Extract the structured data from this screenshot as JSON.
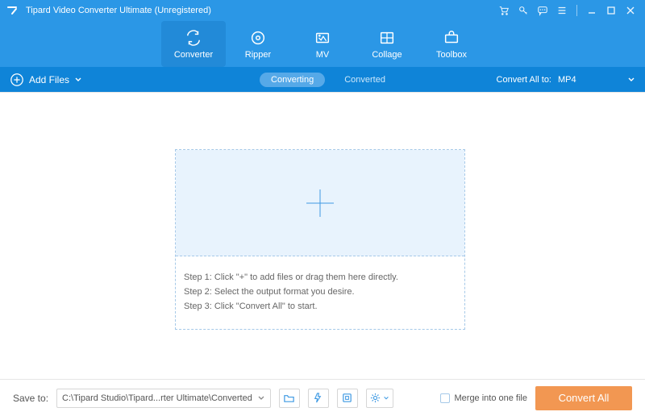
{
  "app": {
    "title": "Tipard Video Converter Ultimate (Unregistered)"
  },
  "tabs": {
    "converter": "Converter",
    "ripper": "Ripper",
    "mv": "MV",
    "collage": "Collage",
    "toolbox": "Toolbox"
  },
  "subbar": {
    "add_files": "Add Files",
    "converting": "Converting",
    "converted": "Converted",
    "convert_all_to": "Convert All to:",
    "output_format": "MP4"
  },
  "steps": {
    "s1": "Step 1: Click \"+\" to add files or drag them here directly.",
    "s2": "Step 2: Select the output format you desire.",
    "s3": "Step 3: Click \"Convert All\" to start."
  },
  "bottom": {
    "save_to": "Save to:",
    "save_path": "C:\\Tipard Studio\\Tipard...rter Ultimate\\Converted",
    "merge": "Merge into one file",
    "convert_all": "Convert All"
  }
}
